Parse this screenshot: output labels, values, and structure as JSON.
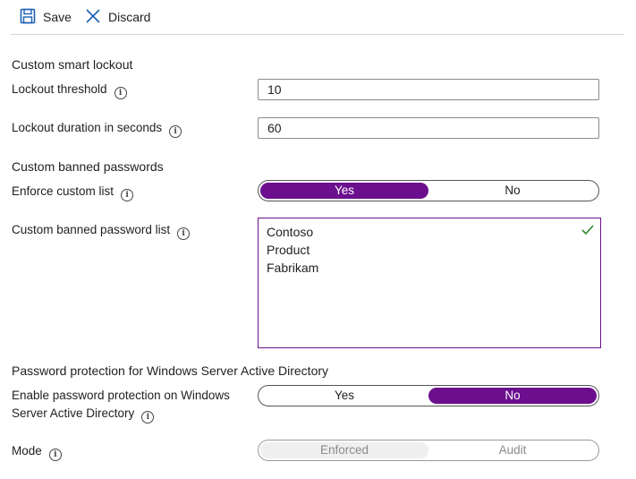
{
  "toolbar": {
    "save_label": "Save",
    "discard_label": "Discard"
  },
  "smart_lockout": {
    "title": "Custom smart lockout",
    "threshold_label": "Lockout threshold",
    "threshold_value": "10",
    "duration_label": "Lockout duration in seconds",
    "duration_value": "60"
  },
  "banned_passwords": {
    "title": "Custom banned passwords",
    "enforce_label": "Enforce custom list",
    "enforce_options": [
      "Yes",
      "No"
    ],
    "enforce_selected": "Yes",
    "list_label": "Custom banned password list",
    "list_items": [
      "Contoso",
      "Product",
      "Fabrikam"
    ]
  },
  "ad_protection": {
    "title": "Password protection for Windows Server Active Directory",
    "enable_label_line1": "Enable password protection on Windows",
    "enable_label_line2": "Server Active Directory",
    "enable_options": [
      "Yes",
      "No"
    ],
    "enable_selected": "No",
    "mode_label": "Mode",
    "mode_options": [
      "Enforced",
      "Audit"
    ],
    "mode_selected": "Enforced"
  },
  "colors": {
    "accent": "#6b0f8e",
    "save_icon": "#1a5fb4",
    "check": "#2e8b2e"
  },
  "icons": {
    "save": "floppy-disk-icon",
    "discard": "x-icon",
    "info": "info-circle-icon",
    "valid": "checkmark-icon"
  }
}
